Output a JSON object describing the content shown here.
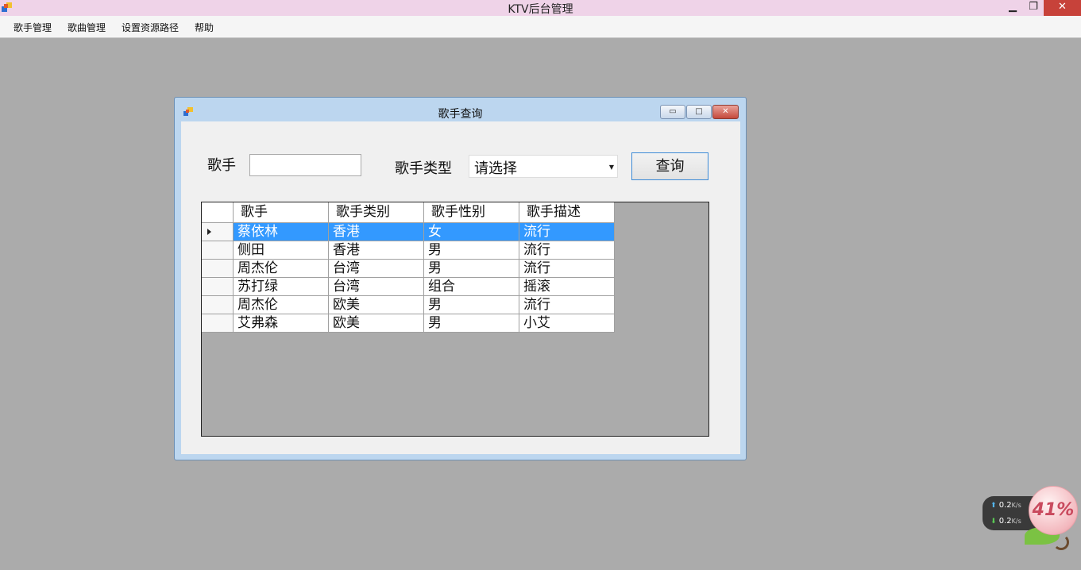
{
  "window": {
    "title": "KTV后台管理"
  },
  "menu": [
    {
      "label": "歌手管理"
    },
    {
      "label": "歌曲管理"
    },
    {
      "label": "设置资源路径"
    },
    {
      "label": "帮助"
    }
  ],
  "dialog": {
    "title": "歌手查询",
    "singer_label": "歌手",
    "singer_value": "",
    "type_label": "歌手类型",
    "type_selected": "请选择",
    "query_button": "查询"
  },
  "grid": {
    "columns": [
      "歌手",
      "歌手类别",
      "歌手性别",
      "歌手描述"
    ],
    "rows": [
      [
        "蔡依林",
        "香港",
        "女",
        "流行"
      ],
      [
        "侧田",
        "香港",
        "男",
        "流行"
      ],
      [
        "周杰伦",
        "台湾",
        "男",
        "流行"
      ],
      [
        "苏打绿",
        "台湾",
        "组合",
        "摇滚"
      ],
      [
        "周杰伦",
        "欧美",
        "男",
        "流行"
      ],
      [
        "艾弗森",
        "欧美",
        "男",
        "小艾"
      ]
    ],
    "selected_row": 0
  },
  "net_widget": {
    "upload": "0.2",
    "download": "0.2",
    "unit": "K/s",
    "memory_percent": "41%"
  },
  "colors": {
    "selection": "#3399ff",
    "workspace": "#ababab",
    "title_bar": "#efd3e8"
  }
}
